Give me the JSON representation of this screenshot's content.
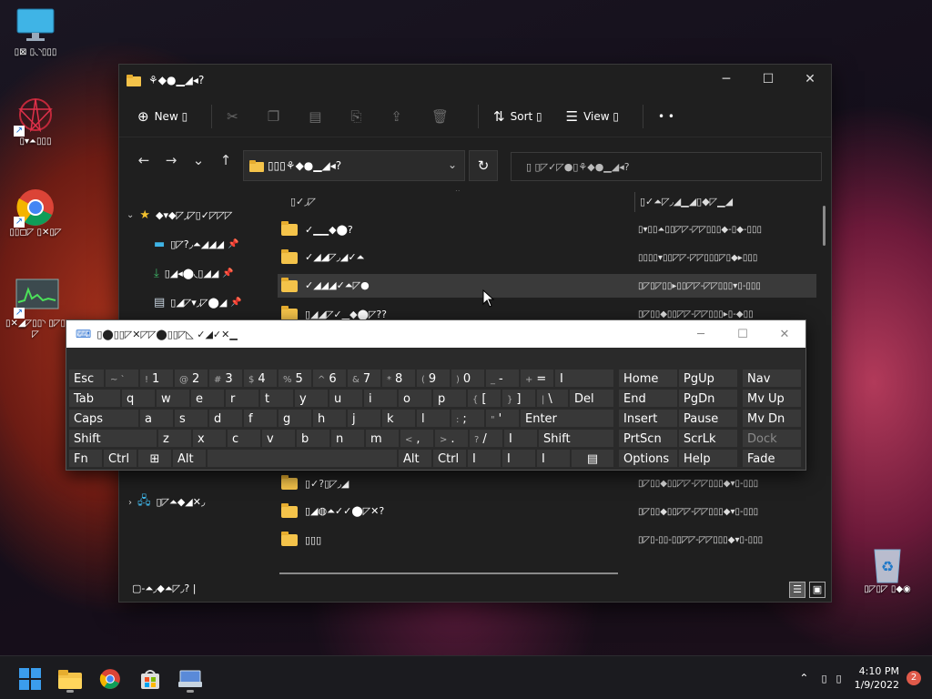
{
  "desktop": {
    "icons": [
      {
        "label": "▯⊠ ▯◟◝▯▯▯"
      },
      {
        "label": "▯▾⏶▯▯▯"
      },
      {
        "label": "▯▯◻◸ ▯✕▯◸"
      },
      {
        "label": "▯✕◢◸▯▯◝ ▯◸▯◸"
      },
      {
        "label": "▯◸▯◸ ▯◆◉"
      }
    ]
  },
  "explorer": {
    "title": "⚘◆●▁◢◂?",
    "commands": {
      "new": "New ▯",
      "sort": "Sort ▯",
      "view": "View ▯"
    },
    "address": "▯▯▯⚘◆●▁◢◂?",
    "search_placeholder": "▯  ▯◸✓◸●▯⚘◆●▁◢◂?",
    "nav": {
      "quick_access": "◆▾◆◸◞◸▯✓◸◸◸",
      "desktop": "▯◸?◞⏶◢◢◢",
      "downloads": "▯◢◂⬤◟▯◢◢",
      "documents": "▯◢◸▾◞◸⬤◢",
      "network": "▯◸⏶◆◢✕◞"
    },
    "columns": {
      "name": "▯✓◞◸",
      "date": "▯✓⏶◸◞◢▁◢▯◆◸▁◢"
    },
    "files": [
      {
        "name": "✓▁▁◆⬤?",
        "date": "▯▾▯▯⏶▯▯◸◸-◸◸▯▯▯◆-▯◆-▯▯▯"
      },
      {
        "name": "✓◢◢◸◞◢✓⏶",
        "date": "▯▯▯▯▾▯▯◸◸-◸◸▯▯▯◸▯◆▸▯▯▯"
      },
      {
        "name": "✓◢◢◢✓⏶◸●",
        "date": "▯◸▯◸▯▯▸▯▯◸◸-◸◸▯▯▯▾▯-▯▯▯"
      },
      {
        "name": "▯◢◢◸✓▁◆⬤◸??",
        "date": "▯◸▯▯◆▯▯◸◸-◸◸▯▯▯▸▯-◆▯▯"
      },
      {
        "name": "▯✓?▯◸◞◢",
        "date": "▯◸▯▯◆▯▯◸◸-◸◸▯▯▯◆▾▯-▯▯▯"
      },
      {
        "name": "▯◢◍⏶✓✓⬤◸✕?",
        "date": "▯◸▯▯◆▯▯◸◸-◸◸▯▯▯◆▾▯-▯▯▯"
      },
      {
        "name": "▯▯▯",
        "date": "▯◸▯-▯▯-▯▯◸◸-◸◸▯▯▯◆▾▯-▯▯▯"
      }
    ],
    "status": "▢-⏶◞◆⏶◸◞?  |"
  },
  "osk": {
    "title": "▯⬤▯▯◸✕◸◸⬤▯▯◸◺ ✓◢✓✕▁",
    "rows": {
      "r1": {
        "esc": "Esc",
        "k1": "1",
        "k2": "2",
        "k3": "3",
        "k4": "4",
        "k5": "5",
        "k6": "6",
        "k7": "7",
        "k8": "8",
        "k9": "9",
        "k0": "0",
        "minus": "-",
        "equals": "=",
        "bksp": "I"
      },
      "r2": {
        "tab": "Tab",
        "q": "q",
        "w": "w",
        "e": "e",
        "r": "r",
        "t": "t",
        "y": "y",
        "u": "u",
        "i": "i",
        "o": "o",
        "p": "p",
        "lb": "[",
        "rb": "]",
        "bs": "\\",
        "del": "Del"
      },
      "r3": {
        "caps": "Caps",
        "a": "a",
        "s": "s",
        "d": "d",
        "f": "f",
        "g": "g",
        "h": "h",
        "j": "j",
        "k": "k",
        "l": "l",
        "semi": ";",
        "quote": "'",
        "enter": "Enter"
      },
      "r4": {
        "shift": "Shift",
        "z": "z",
        "x": "x",
        "c": "c",
        "v": "v",
        "b": "b",
        "n": "n",
        "m": "m",
        "comma": ",",
        "period": ".",
        "slash": "/",
        "up": "I",
        "shift2": "Shift"
      },
      "r5": {
        "fn": "Fn",
        "ctrl": "Ctrl",
        "alt": "Alt",
        "alt2": "Alt",
        "ctrl2": "Ctrl",
        "a1": "I",
        "a2": "I",
        "a3": "I"
      }
    },
    "side": {
      "home": "Home",
      "pgup": "PgUp",
      "nav": "Nav",
      "end": "End",
      "pgdn": "PgDn",
      "mvup": "Mv Up",
      "insert": "Insert",
      "pause": "Pause",
      "mvdn": "Mv Dn",
      "prtscn": "PrtScn",
      "scrlk": "ScrLk",
      "dock": "Dock",
      "options": "Options",
      "help": "Help",
      "fade": "Fade"
    }
  },
  "taskbar": {
    "time": "4:10 PM",
    "date": "1/9/2022",
    "notifications": "2"
  }
}
